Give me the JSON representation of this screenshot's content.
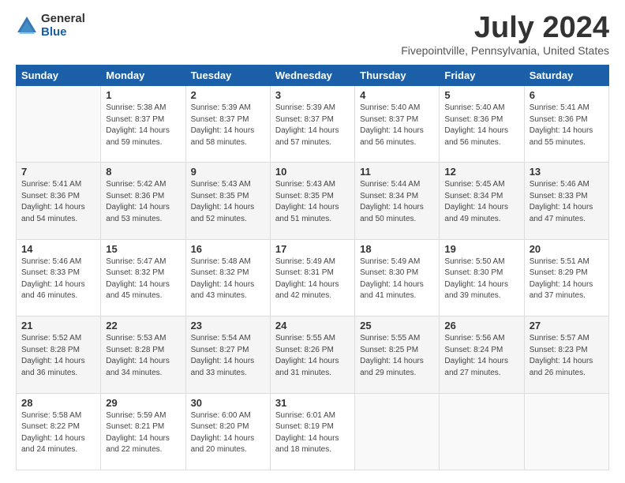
{
  "logo": {
    "general": "General",
    "blue": "Blue"
  },
  "title": "July 2024",
  "location": "Fivepointville, Pennsylvania, United States",
  "days_header": [
    "Sunday",
    "Monday",
    "Tuesday",
    "Wednesday",
    "Thursday",
    "Friday",
    "Saturday"
  ],
  "weeks": [
    [
      {
        "day": "",
        "info": ""
      },
      {
        "day": "1",
        "info": "Sunrise: 5:38 AM\nSunset: 8:37 PM\nDaylight: 14 hours\nand 59 minutes."
      },
      {
        "day": "2",
        "info": "Sunrise: 5:39 AM\nSunset: 8:37 PM\nDaylight: 14 hours\nand 58 minutes."
      },
      {
        "day": "3",
        "info": "Sunrise: 5:39 AM\nSunset: 8:37 PM\nDaylight: 14 hours\nand 57 minutes."
      },
      {
        "day": "4",
        "info": "Sunrise: 5:40 AM\nSunset: 8:37 PM\nDaylight: 14 hours\nand 56 minutes."
      },
      {
        "day": "5",
        "info": "Sunrise: 5:40 AM\nSunset: 8:36 PM\nDaylight: 14 hours\nand 56 minutes."
      },
      {
        "day": "6",
        "info": "Sunrise: 5:41 AM\nSunset: 8:36 PM\nDaylight: 14 hours\nand 55 minutes."
      }
    ],
    [
      {
        "day": "7",
        "info": "Sunrise: 5:41 AM\nSunset: 8:36 PM\nDaylight: 14 hours\nand 54 minutes."
      },
      {
        "day": "8",
        "info": "Sunrise: 5:42 AM\nSunset: 8:36 PM\nDaylight: 14 hours\nand 53 minutes."
      },
      {
        "day": "9",
        "info": "Sunrise: 5:43 AM\nSunset: 8:35 PM\nDaylight: 14 hours\nand 52 minutes."
      },
      {
        "day": "10",
        "info": "Sunrise: 5:43 AM\nSunset: 8:35 PM\nDaylight: 14 hours\nand 51 minutes."
      },
      {
        "day": "11",
        "info": "Sunrise: 5:44 AM\nSunset: 8:34 PM\nDaylight: 14 hours\nand 50 minutes."
      },
      {
        "day": "12",
        "info": "Sunrise: 5:45 AM\nSunset: 8:34 PM\nDaylight: 14 hours\nand 49 minutes."
      },
      {
        "day": "13",
        "info": "Sunrise: 5:46 AM\nSunset: 8:33 PM\nDaylight: 14 hours\nand 47 minutes."
      }
    ],
    [
      {
        "day": "14",
        "info": "Sunrise: 5:46 AM\nSunset: 8:33 PM\nDaylight: 14 hours\nand 46 minutes."
      },
      {
        "day": "15",
        "info": "Sunrise: 5:47 AM\nSunset: 8:32 PM\nDaylight: 14 hours\nand 45 minutes."
      },
      {
        "day": "16",
        "info": "Sunrise: 5:48 AM\nSunset: 8:32 PM\nDaylight: 14 hours\nand 43 minutes."
      },
      {
        "day": "17",
        "info": "Sunrise: 5:49 AM\nSunset: 8:31 PM\nDaylight: 14 hours\nand 42 minutes."
      },
      {
        "day": "18",
        "info": "Sunrise: 5:49 AM\nSunset: 8:30 PM\nDaylight: 14 hours\nand 41 minutes."
      },
      {
        "day": "19",
        "info": "Sunrise: 5:50 AM\nSunset: 8:30 PM\nDaylight: 14 hours\nand 39 minutes."
      },
      {
        "day": "20",
        "info": "Sunrise: 5:51 AM\nSunset: 8:29 PM\nDaylight: 14 hours\nand 37 minutes."
      }
    ],
    [
      {
        "day": "21",
        "info": "Sunrise: 5:52 AM\nSunset: 8:28 PM\nDaylight: 14 hours\nand 36 minutes."
      },
      {
        "day": "22",
        "info": "Sunrise: 5:53 AM\nSunset: 8:28 PM\nDaylight: 14 hours\nand 34 minutes."
      },
      {
        "day": "23",
        "info": "Sunrise: 5:54 AM\nSunset: 8:27 PM\nDaylight: 14 hours\nand 33 minutes."
      },
      {
        "day": "24",
        "info": "Sunrise: 5:55 AM\nSunset: 8:26 PM\nDaylight: 14 hours\nand 31 minutes."
      },
      {
        "day": "25",
        "info": "Sunrise: 5:55 AM\nSunset: 8:25 PM\nDaylight: 14 hours\nand 29 minutes."
      },
      {
        "day": "26",
        "info": "Sunrise: 5:56 AM\nSunset: 8:24 PM\nDaylight: 14 hours\nand 27 minutes."
      },
      {
        "day": "27",
        "info": "Sunrise: 5:57 AM\nSunset: 8:23 PM\nDaylight: 14 hours\nand 26 minutes."
      }
    ],
    [
      {
        "day": "28",
        "info": "Sunrise: 5:58 AM\nSunset: 8:22 PM\nDaylight: 14 hours\nand 24 minutes."
      },
      {
        "day": "29",
        "info": "Sunrise: 5:59 AM\nSunset: 8:21 PM\nDaylight: 14 hours\nand 22 minutes."
      },
      {
        "day": "30",
        "info": "Sunrise: 6:00 AM\nSunset: 8:20 PM\nDaylight: 14 hours\nand 20 minutes."
      },
      {
        "day": "31",
        "info": "Sunrise: 6:01 AM\nSunset: 8:19 PM\nDaylight: 14 hours\nand 18 minutes."
      },
      {
        "day": "",
        "info": ""
      },
      {
        "day": "",
        "info": ""
      },
      {
        "day": "",
        "info": ""
      }
    ]
  ]
}
